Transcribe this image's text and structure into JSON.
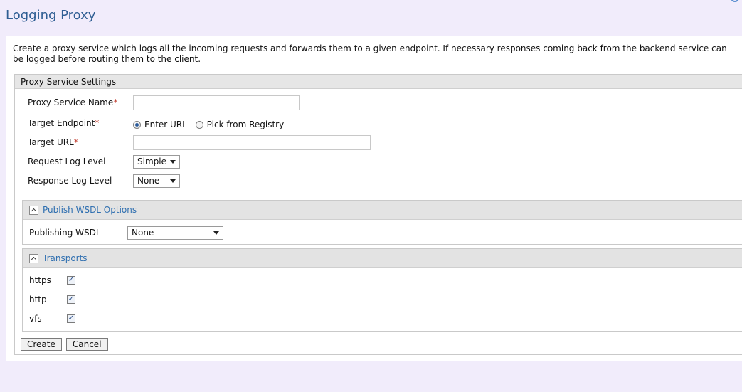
{
  "page": {
    "title": "Logging Proxy",
    "description": "Create a proxy service which logs all the incoming requests and forwards them to a given endpoint. If necessary responses coming back from the backend service can be logged before routing them to the client."
  },
  "settings": {
    "header": "Proxy Service Settings",
    "required_mark": "*",
    "proxy_service_name": {
      "label": "Proxy Service Name",
      "value": ""
    },
    "target_endpoint": {
      "label": "Target Endpoint",
      "options": [
        "Enter URL",
        "Pick from Registry"
      ],
      "selected": "Enter URL"
    },
    "target_url": {
      "label": "Target URL",
      "value": ""
    },
    "request_log_level": {
      "label": "Request Log Level",
      "value": "Simple"
    },
    "response_log_level": {
      "label": "Response Log Level",
      "value": "None"
    }
  },
  "publish_wsdl": {
    "header": "Publish WSDL Options",
    "publishing_wsdl": {
      "label": "Publishing WSDL",
      "value": "None"
    }
  },
  "transports": {
    "header": "Transports",
    "items": [
      {
        "label": "https",
        "checked": true
      },
      {
        "label": "http",
        "checked": true
      },
      {
        "label": "vfs",
        "checked": true
      }
    ],
    "check_glyph": "✓"
  },
  "actions": {
    "create_label": "Create",
    "cancel_label": "Cancel"
  },
  "colors": {
    "accent": "#2f5e93",
    "link": "#2f6fb0",
    "background": "#f1ecfb",
    "required": "#c0392b"
  }
}
